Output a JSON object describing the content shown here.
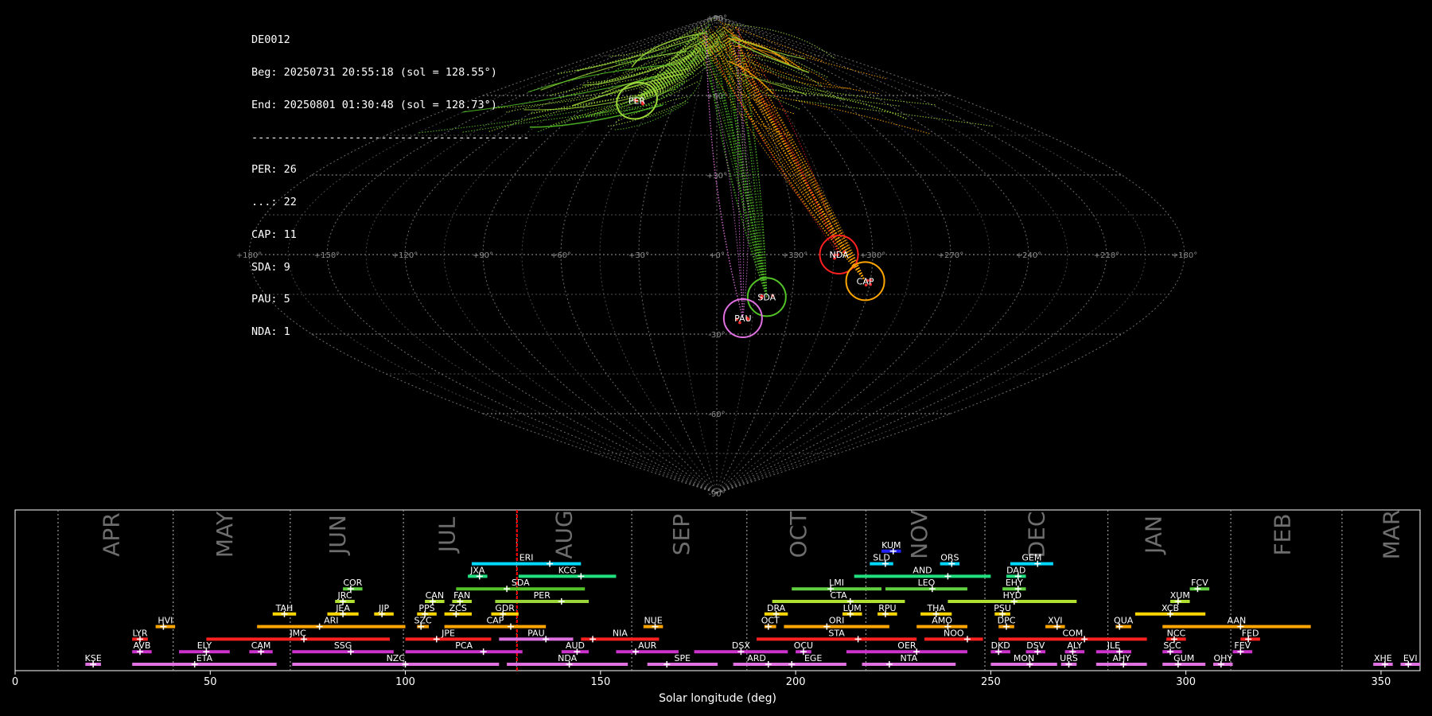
{
  "info": {
    "station": "DE0012",
    "beg": "Beg: 20250731 20:55:18 (sol = 128.55°)",
    "end": "End: 20250801 01:30:48 (sol = 128.73°)",
    "separator": "-------------------------------------------",
    "counts": [
      "PER: 26",
      "...: 22",
      "CAP: 11",
      "SDA: 9",
      "PAU: 5",
      "NDA: 1"
    ]
  },
  "colors": {
    "PER": "#9ad63a",
    "SDA": "#53c227",
    "CAP": "#ffa500",
    "NDA": "#ff2020",
    "PAU": "#e070e0",
    "sporadic": "#d08a2a",
    "grid": "#8a8a8a",
    "marker": "#ff2a2a",
    "current_sol": "#ff0000"
  },
  "chart_data": [
    {
      "type": "scatter",
      "title": "",
      "projection": "sinusoidal (sky map)",
      "lon_tick_labels": [
        "+180°",
        "+150°",
        "+120°",
        "+90°",
        "+60°",
        "+30°",
        "+0°",
        "+330°",
        "+300°",
        "+270°",
        "+240°",
        "+210°",
        "+180°"
      ],
      "lat_tick_labels": [
        "+90°",
        "+60°",
        "+30°",
        "-30°",
        "-60°",
        "-90°"
      ],
      "grid": true,
      "radiants": [
        {
          "name": "PER",
          "lon": 58,
          "lat": 58,
          "color": "#9ad63a"
        },
        {
          "name": "NDA",
          "lon": 313,
          "lat": 0,
          "color": "#ff2020"
        },
        {
          "name": "CAP",
          "lon": 302,
          "lat": -10,
          "color": "#ffa500"
        },
        {
          "name": "SDA",
          "lon": 340,
          "lat": -16,
          "color": "#53c227"
        },
        {
          "name": "PAU",
          "lon": 349,
          "lat": -24,
          "color": "#e070e0"
        }
      ]
    },
    {
      "type": "timeline",
      "xlabel": "Solar longitude (deg)",
      "xlim": [
        0,
        360
      ],
      "x_ticks": [
        0,
        50,
        100,
        150,
        200,
        250,
        300,
        350
      ],
      "current_sol": 128.6,
      "months": [
        {
          "label": "APR",
          "start": 11,
          "mid": 25
        },
        {
          "label": "MAY",
          "start": 40.5,
          "mid": 54
        },
        {
          "label": "JUN",
          "start": 70.5,
          "mid": 83
        },
        {
          "label": "JUL",
          "start": 99.5,
          "mid": 111
        },
        {
          "label": "AUG",
          "start": 128.5,
          "mid": 141
        },
        {
          "label": "SEP",
          "start": 158,
          "mid": 171
        },
        {
          "label": "OCT",
          "start": 187.5,
          "mid": 201
        },
        {
          "label": "NOV",
          "start": 218,
          "mid": 232
        },
        {
          "label": "DEC",
          "start": 248.5,
          "mid": 262
        },
        {
          "label": "JAN",
          "start": 280,
          "mid": 292
        },
        {
          "label": "FEB",
          "start": 311.5,
          "mid": 325
        },
        {
          "label": "MAR",
          "start": 340,
          "mid": 353
        }
      ],
      "showers": [
        {
          "code": "KUM",
          "start": 222,
          "end": 227,
          "peak": 225,
          "row": 9,
          "color": "#2222ff"
        },
        {
          "code": "ERI",
          "start": 117,
          "end": 145,
          "peak": 137,
          "row": 8,
          "color": "#00d8ff"
        },
        {
          "code": "SLD",
          "start": 219,
          "end": 225,
          "peak": 223,
          "row": 8,
          "color": "#00d8ff"
        },
        {
          "code": "ORS",
          "start": 237,
          "end": 242,
          "peak": 240,
          "row": 8,
          "color": "#00d8ff"
        },
        {
          "code": "GEM",
          "start": 255,
          "end": 266,
          "peak": 262,
          "row": 8,
          "color": "#00d8ff"
        },
        {
          "code": "JXA",
          "start": 116,
          "end": 121,
          "peak": 119,
          "row": 7,
          "color": "#20e080"
        },
        {
          "code": "KCG",
          "start": 129,
          "end": 154,
          "peak": 145,
          "row": 7,
          "color": "#20e080"
        },
        {
          "code": "AND",
          "start": 215,
          "end": 250,
          "peak": 239,
          "row": 7,
          "color": "#20e080"
        },
        {
          "code": "DAD",
          "start": 254,
          "end": 259,
          "peak": 257,
          "row": 7,
          "color": "#20e080"
        },
        {
          "code": "COR",
          "start": 84,
          "end": 89,
          "peak": 86,
          "row": 6,
          "color": "#60d040"
        },
        {
          "code": "SDA",
          "start": 113,
          "end": 146,
          "peak": 126,
          "row": 6,
          "color": "#53c227"
        },
        {
          "code": "LMI",
          "start": 199,
          "end": 222,
          "peak": 209,
          "row": 6,
          "color": "#60d040"
        },
        {
          "code": "LEO",
          "start": 223,
          "end": 244,
          "peak": 235,
          "row": 6,
          "color": "#60d040"
        },
        {
          "code": "EHY",
          "start": 253,
          "end": 259,
          "peak": 257,
          "row": 6,
          "color": "#60d040"
        },
        {
          "code": "FCV",
          "start": 301,
          "end": 306,
          "peak": 303,
          "row": 6,
          "color": "#60d040"
        },
        {
          "code": "JRC",
          "start": 82,
          "end": 87,
          "peak": 84,
          "row": 5,
          "color": "#b0e030"
        },
        {
          "code": "CAN",
          "start": 105,
          "end": 110,
          "peak": 107,
          "row": 5,
          "color": "#b0e030"
        },
        {
          "code": "FAN",
          "start": 112,
          "end": 117,
          "peak": 114,
          "row": 5,
          "color": "#b0e030"
        },
        {
          "code": "PER",
          "start": 123,
          "end": 147,
          "peak": 140,
          "row": 5,
          "color": "#9ad63a"
        },
        {
          "code": "CTA",
          "start": 194,
          "end": 228,
          "peak": 214,
          "row": 5,
          "color": "#b0e030"
        },
        {
          "code": "HYD",
          "start": 239,
          "end": 272,
          "peak": 256,
          "row": 5,
          "color": "#b0e030"
        },
        {
          "code": "XUM",
          "start": 296,
          "end": 301,
          "peak": 298,
          "row": 5,
          "color": "#b0e030"
        },
        {
          "code": "TAH",
          "start": 66,
          "end": 72,
          "peak": 69,
          "row": 4,
          "color": "#ffd700"
        },
        {
          "code": "JEA",
          "start": 80,
          "end": 88,
          "peak": 84,
          "row": 4,
          "color": "#ffd700"
        },
        {
          "code": "JIP",
          "start": 92,
          "end": 97,
          "peak": 94,
          "row": 4,
          "color": "#ffd700"
        },
        {
          "code": "PPS",
          "start": 103,
          "end": 108,
          "peak": 105,
          "row": 4,
          "color": "#ffd700"
        },
        {
          "code": "ZCS",
          "start": 110,
          "end": 117,
          "peak": 113,
          "row": 4,
          "color": "#ffd700"
        },
        {
          "code": "GDR",
          "start": 122,
          "end": 129,
          "peak": 125,
          "row": 4,
          "color": "#ffd700"
        },
        {
          "code": "DRA",
          "start": 192,
          "end": 198,
          "peak": 195,
          "row": 4,
          "color": "#ffd700"
        },
        {
          "code": "LUM",
          "start": 212,
          "end": 217,
          "peak": 214,
          "row": 4,
          "color": "#ffd700"
        },
        {
          "code": "RPU",
          "start": 221,
          "end": 226,
          "peak": 223,
          "row": 4,
          "color": "#ffd700"
        },
        {
          "code": "THA",
          "start": 232,
          "end": 240,
          "peak": 236,
          "row": 4,
          "color": "#ffd700"
        },
        {
          "code": "PSU",
          "start": 251,
          "end": 255,
          "peak": 253,
          "row": 4,
          "color": "#ffd700"
        },
        {
          "code": "XCB",
          "start": 287,
          "end": 305,
          "peak": 296,
          "row": 4,
          "color": "#ffd700"
        },
        {
          "code": "HVI",
          "start": 36,
          "end": 41,
          "peak": 38,
          "row": 3,
          "color": "#ffa500"
        },
        {
          "code": "ARI",
          "start": 62,
          "end": 100,
          "peak": 78,
          "row": 3,
          "color": "#ffa500"
        },
        {
          "code": "SZC",
          "start": 103,
          "end": 106,
          "peak": 104,
          "row": 3,
          "color": "#ffa500"
        },
        {
          "code": "CAP",
          "start": 110,
          "end": 136,
          "peak": 127,
          "row": 3,
          "color": "#ffa500"
        },
        {
          "code": "NUE",
          "start": 161,
          "end": 166,
          "peak": 164,
          "row": 3,
          "color": "#ffa500"
        },
        {
          "code": "OCT",
          "start": 192,
          "end": 195,
          "peak": 193,
          "row": 3,
          "color": "#ffa500"
        },
        {
          "code": "ORI",
          "start": 197,
          "end": 224,
          "peak": 208,
          "row": 3,
          "color": "#ffa500"
        },
        {
          "code": "AMO",
          "start": 231,
          "end": 244,
          "peak": 239,
          "row": 3,
          "color": "#ffa500"
        },
        {
          "code": "DPC",
          "start": 252,
          "end": 256,
          "peak": 254,
          "row": 3,
          "color": "#ffa500"
        },
        {
          "code": "XVI",
          "start": 264,
          "end": 269,
          "peak": 267,
          "row": 3,
          "color": "#ffa500"
        },
        {
          "code": "QUA",
          "start": 282,
          "end": 286,
          "peak": 283,
          "row": 3,
          "color": "#ffa500"
        },
        {
          "code": "AAN",
          "start": 294,
          "end": 332,
          "peak": 314,
          "row": 3,
          "color": "#ffa500"
        },
        {
          "code": "LYR",
          "start": 30,
          "end": 34,
          "peak": 32,
          "row": 2,
          "color": "#ff2020"
        },
        {
          "code": "JMC",
          "start": 49,
          "end": 96,
          "peak": 74,
          "row": 2,
          "color": "#ff2020"
        },
        {
          "code": "JPE",
          "start": 100,
          "end": 122,
          "peak": 108,
          "row": 2,
          "color": "#ff2020"
        },
        {
          "code": "PAU",
          "start": 124,
          "end": 143,
          "peak": 136,
          "row": 2,
          "color": "#e070e0"
        },
        {
          "code": "NIA",
          "start": 145,
          "end": 165,
          "peak": 148,
          "row": 2,
          "color": "#ff2020"
        },
        {
          "code": "STA",
          "start": 190,
          "end": 231,
          "peak": 216,
          "row": 2,
          "color": "#ff2020"
        },
        {
          "code": "NOO",
          "start": 233,
          "end": 248,
          "peak": 244,
          "row": 2,
          "color": "#ff2020"
        },
        {
          "code": "COM",
          "start": 252,
          "end": 290,
          "peak": 274,
          "row": 2,
          "color": "#ff2020"
        },
        {
          "code": "NCC",
          "start": 295,
          "end": 300,
          "peak": 297,
          "row": 2,
          "color": "#ff2020"
        },
        {
          "code": "FED",
          "start": 314,
          "end": 319,
          "peak": 316,
          "row": 2,
          "color": "#ff2020"
        },
        {
          "code": "AVB",
          "start": 30,
          "end": 35,
          "peak": 32,
          "row": 1,
          "color": "#cc33cc"
        },
        {
          "code": "ELY",
          "start": 42,
          "end": 55,
          "peak": 49,
          "row": 1,
          "color": "#cc33cc"
        },
        {
          "code": "CAM",
          "start": 60,
          "end": 66,
          "peak": 63,
          "row": 1,
          "color": "#cc33cc"
        },
        {
          "code": "SSG",
          "start": 71,
          "end": 97,
          "peak": 86,
          "row": 1,
          "color": "#cc33cc"
        },
        {
          "code": "PCA",
          "start": 100,
          "end": 130,
          "peak": 120,
          "row": 1,
          "color": "#cc33cc"
        },
        {
          "code": "AUD",
          "start": 140,
          "end": 147,
          "peak": 144,
          "row": 1,
          "color": "#cc33cc"
        },
        {
          "code": "AUR",
          "start": 154,
          "end": 170,
          "peak": 159,
          "row": 1,
          "color": "#cc33cc"
        },
        {
          "code": "DSX",
          "start": 174,
          "end": 198,
          "peak": 186,
          "row": 1,
          "color": "#cc33cc"
        },
        {
          "code": "OCU",
          "start": 200,
          "end": 204,
          "peak": 202,
          "row": 1,
          "color": "#cc33cc"
        },
        {
          "code": "OER",
          "start": 213,
          "end": 244,
          "peak": 231,
          "row": 1,
          "color": "#cc33cc"
        },
        {
          "code": "DKD",
          "start": 250,
          "end": 255,
          "peak": 252,
          "row": 1,
          "color": "#cc33cc"
        },
        {
          "code": "DSV",
          "start": 259,
          "end": 264,
          "peak": 262,
          "row": 1,
          "color": "#cc33cc"
        },
        {
          "code": "ALY",
          "start": 269,
          "end": 274,
          "peak": 271,
          "row": 1,
          "color": "#cc33cc"
        },
        {
          "code": "JLE",
          "start": 277,
          "end": 286,
          "peak": 283,
          "row": 1,
          "color": "#cc33cc"
        },
        {
          "code": "SCC",
          "start": 294,
          "end": 299,
          "peak": 296,
          "row": 1,
          "color": "#cc33cc"
        },
        {
          "code": "FEV",
          "start": 312,
          "end": 317,
          "peak": 314,
          "row": 1,
          "color": "#cc33cc"
        },
        {
          "code": "KSE",
          "start": 18,
          "end": 22,
          "peak": 20,
          "row": 0,
          "color": "#e070e0"
        },
        {
          "code": "ETA",
          "start": 30,
          "end": 67,
          "peak": 46,
          "row": 0,
          "color": "#e070e0"
        },
        {
          "code": "NZC",
          "start": 71,
          "end": 124,
          "peak": 100,
          "row": 0,
          "color": "#e070e0"
        },
        {
          "code": "NDA",
          "start": 126,
          "end": 157,
          "peak": 142,
          "row": 0,
          "color": "#e070e0"
        },
        {
          "code": "SPE",
          "start": 162,
          "end": 180,
          "peak": 167,
          "row": 0,
          "color": "#e070e0"
        },
        {
          "code": "ARD",
          "start": 184,
          "end": 196,
          "peak": 193,
          "row": 0,
          "color": "#e070e0"
        },
        {
          "code": "EGE",
          "start": 196,
          "end": 213,
          "peak": 199,
          "row": 0,
          "color": "#e070e0"
        },
        {
          "code": "NTA",
          "start": 217,
          "end": 241,
          "peak": 224,
          "row": 0,
          "color": "#e070e0"
        },
        {
          "code": "MON",
          "start": 250,
          "end": 267,
          "peak": 260,
          "row": 0,
          "color": "#e070e0"
        },
        {
          "code": "URS",
          "start": 268,
          "end": 272,
          "peak": 270,
          "row": 0,
          "color": "#e070e0"
        },
        {
          "code": "AHY",
          "start": 277,
          "end": 290,
          "peak": 284,
          "row": 0,
          "color": "#e070e0"
        },
        {
          "code": "GUM",
          "start": 294,
          "end": 305,
          "peak": 298,
          "row": 0,
          "color": "#e070e0"
        },
        {
          "code": "OHY",
          "start": 307,
          "end": 312,
          "peak": 309,
          "row": 0,
          "color": "#e070e0"
        },
        {
          "code": "XHE",
          "start": 348,
          "end": 353,
          "peak": 351,
          "row": 0,
          "color": "#e070e0"
        },
        {
          "code": "EVI",
          "start": 355,
          "end": 360,
          "peak": 357,
          "row": 0,
          "color": "#e070e0"
        }
      ]
    }
  ]
}
